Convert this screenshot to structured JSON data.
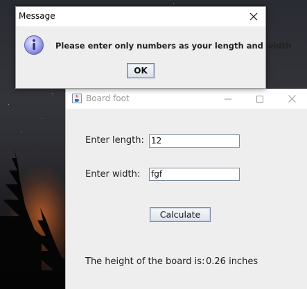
{
  "dialog": {
    "title": "Message",
    "icon": "info-icon",
    "message": "Please enter only numbers as your length and width",
    "ok_label": "OK"
  },
  "board_window": {
    "title": "Board foot",
    "icon": "java-cup-icon",
    "length_label": "Enter length:",
    "length_value": "12",
    "width_label": "Enter width:",
    "width_value": "fgf",
    "calculate_label": "Calculate",
    "result_label": "The height of the board is:",
    "result_value": "0.26 inches"
  },
  "colors": {
    "window_bg": "#eeeeee",
    "titlebar_bg": "#ffffff",
    "button_border": "#7a8aa6",
    "info_icon": "#7b7fd6"
  }
}
